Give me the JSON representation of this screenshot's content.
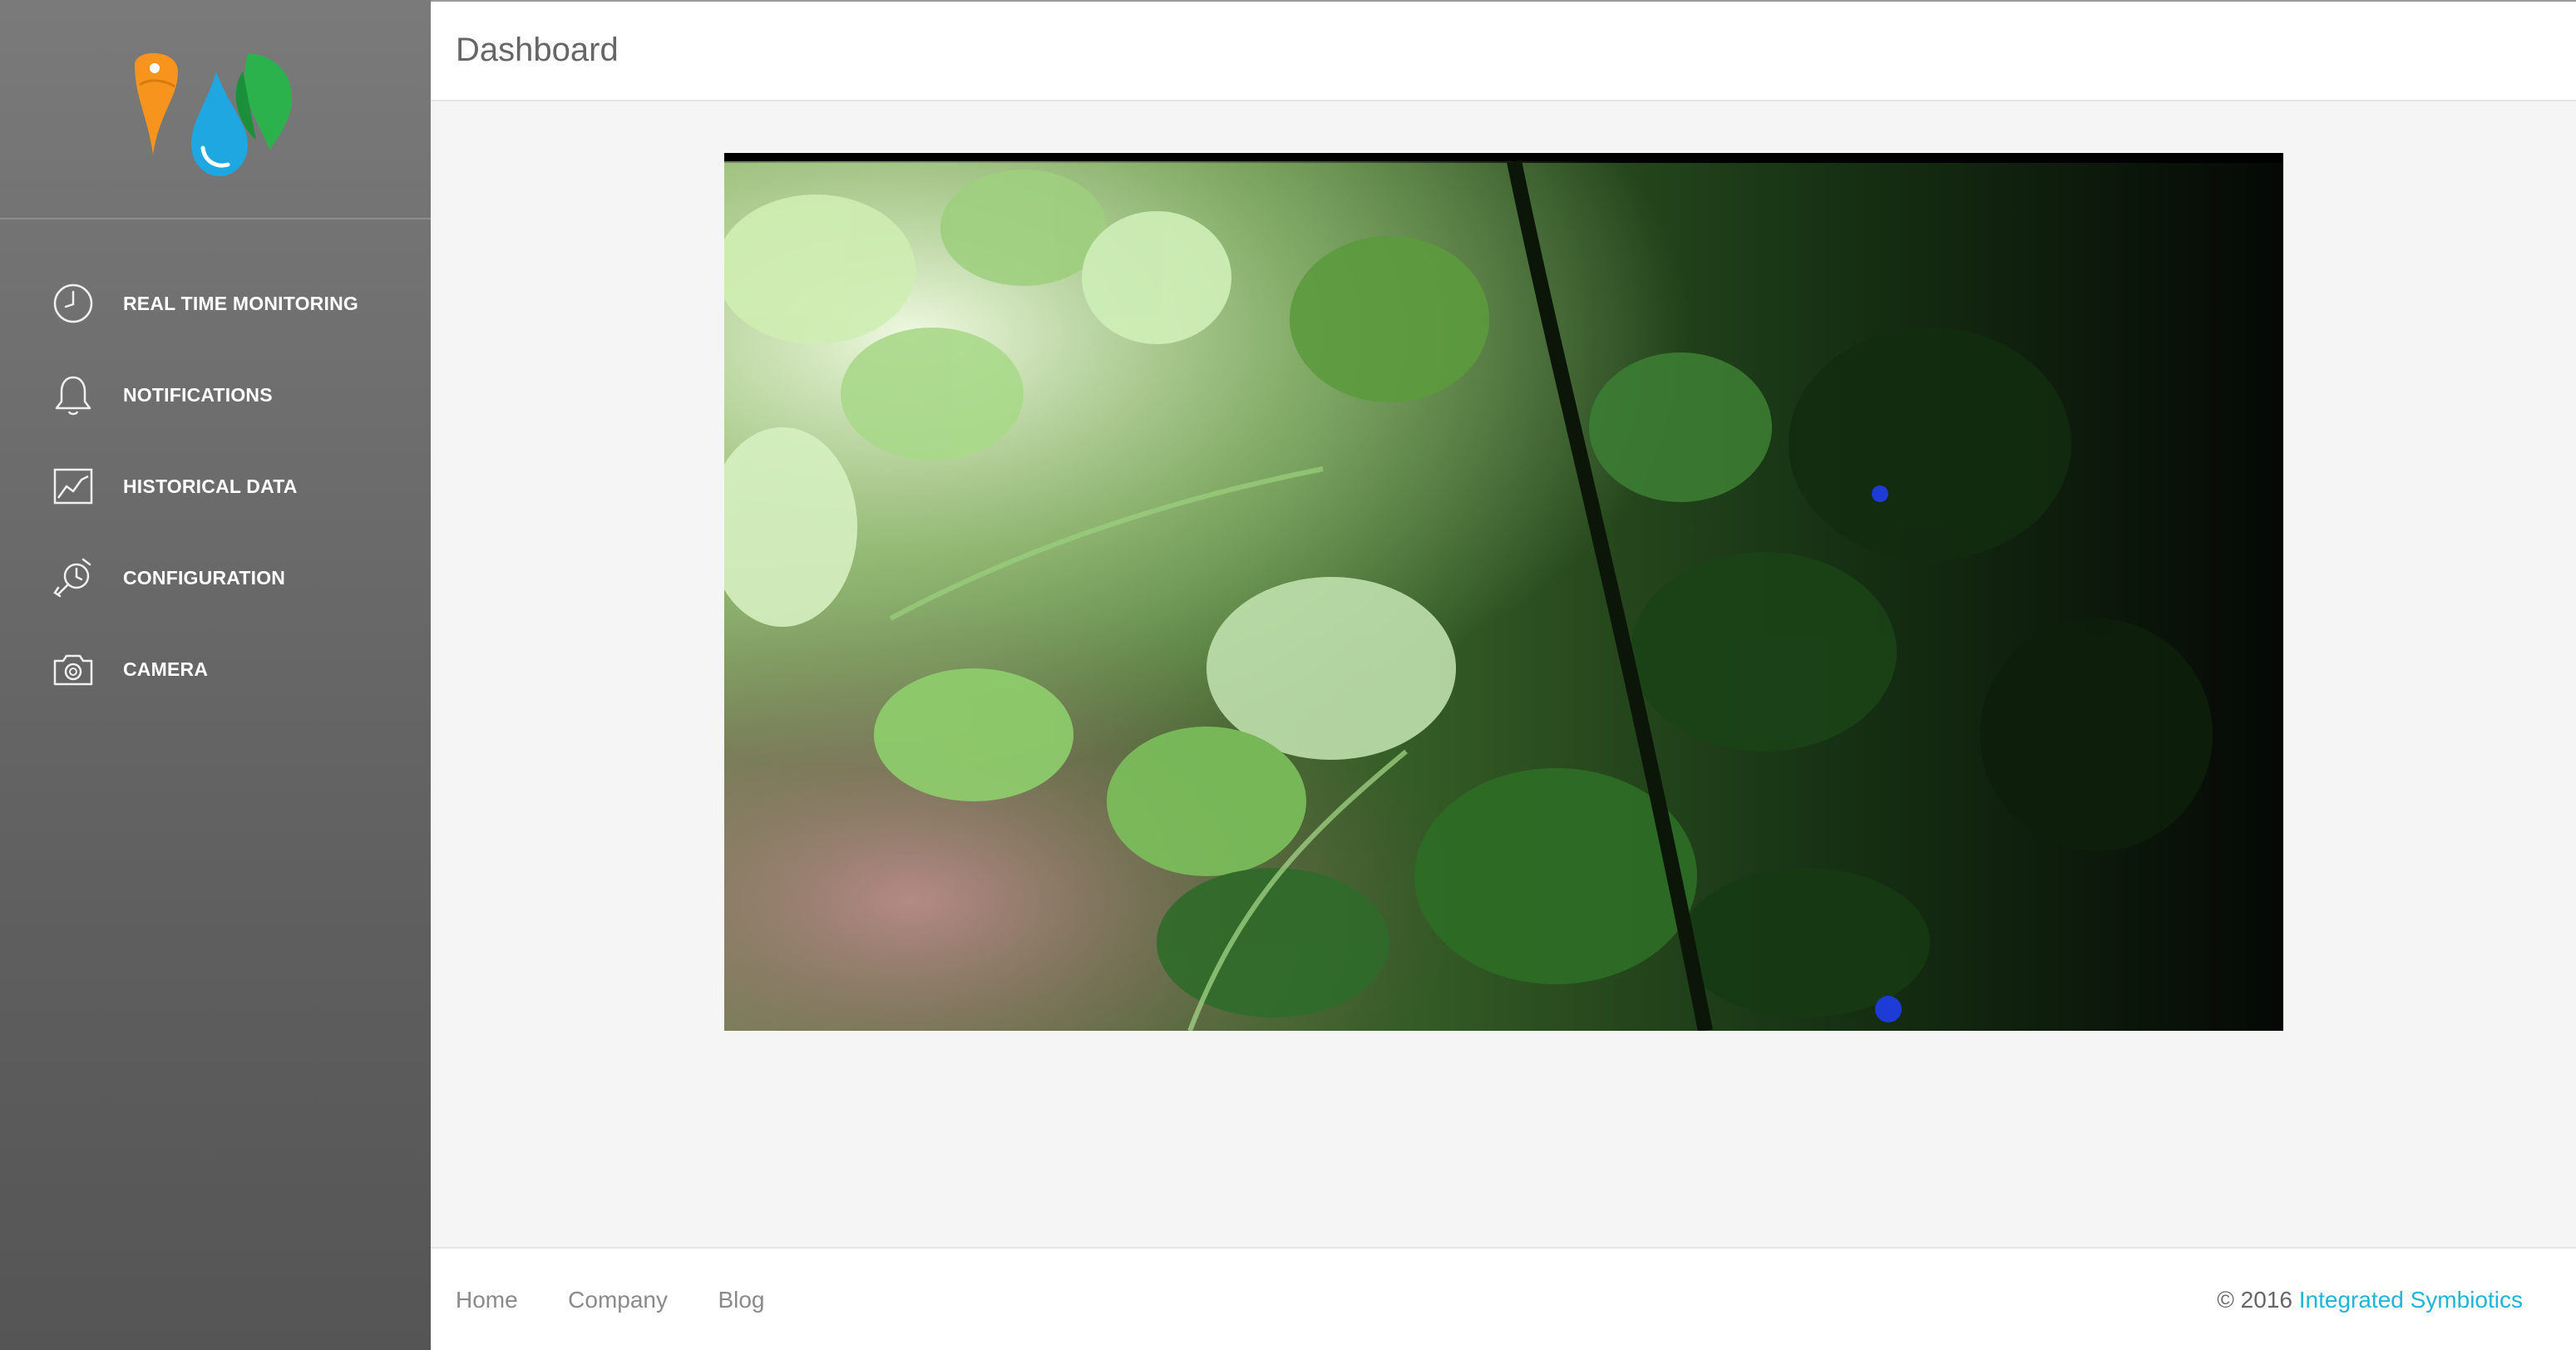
{
  "sidebar": {
    "logo_alt": "Integrated Symbiotics logo",
    "items": [
      {
        "label": "REAL TIME MONITORING",
        "icon": "clock-icon"
      },
      {
        "label": "NOTIFICATIONS",
        "icon": "bell-icon"
      },
      {
        "label": "HISTORICAL DATA",
        "icon": "chart-icon"
      },
      {
        "label": "CONFIGURATION",
        "icon": "wrench-clock-icon"
      },
      {
        "label": "CAMERA",
        "icon": "camera-icon"
      }
    ]
  },
  "header": {
    "title": "Dashboard"
  },
  "main": {
    "camera_feed": "camera-feed-image"
  },
  "footer": {
    "links": [
      "Home",
      "Company",
      "Blog"
    ],
    "copyright_prefix": "© 2016",
    "copyright_link": "Integrated Symbiotics"
  },
  "colors": {
    "sidebar_top": "#7a7a7a",
    "sidebar_bottom": "#555555",
    "accent_link": "#1fb4d8",
    "logo_orange": "#f7941d",
    "logo_blue": "#1ea7e1",
    "logo_green": "#2bb24c"
  }
}
